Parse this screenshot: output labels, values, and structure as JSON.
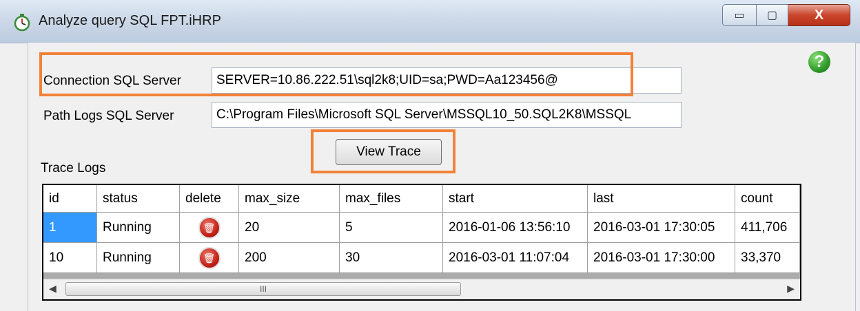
{
  "window": {
    "title": "Analyze query SQL FPT.iHRP",
    "minimize_glyph": "▭",
    "maximize_glyph": "▢",
    "close_glyph": "X"
  },
  "form": {
    "connection_label": "Connection SQL Server",
    "connection_value": "SERVER=10.86.222.51\\sql2k8;UID=sa;PWD=Aa123456@",
    "path_label": "Path Logs SQL Server",
    "path_value": "C:\\Program Files\\Microsoft SQL Server\\MSSQL10_50.SQL2K8\\MSSQL",
    "view_button": "View Trace",
    "trace_logs_label": "Trace Logs",
    "help_glyph": "?"
  },
  "grid": {
    "columns": [
      "id",
      "status",
      "delete",
      "max_size",
      "max_files",
      "start",
      "last",
      "count"
    ],
    "rows": [
      {
        "id": "1",
        "status": "Running",
        "max_size": "20",
        "max_files": "5",
        "start": "2016-01-06 13:56:10",
        "last": "2016-03-01 17:30:05",
        "count": "411,706"
      },
      {
        "id": "10",
        "status": "Running",
        "max_size": "200",
        "max_files": "30",
        "start": "2016-03-01 11:07:04",
        "last": "2016-03-01 17:30:00",
        "count": "33,370"
      }
    ],
    "scroll_left": "◀",
    "scroll_right": "▶",
    "scroll_grip": "III"
  },
  "icons": {
    "app": "stopwatch-icon",
    "help": "help-icon",
    "delete": "trash-icon"
  },
  "colors": {
    "highlight": "#f2823a",
    "selection": "#3399ff"
  }
}
